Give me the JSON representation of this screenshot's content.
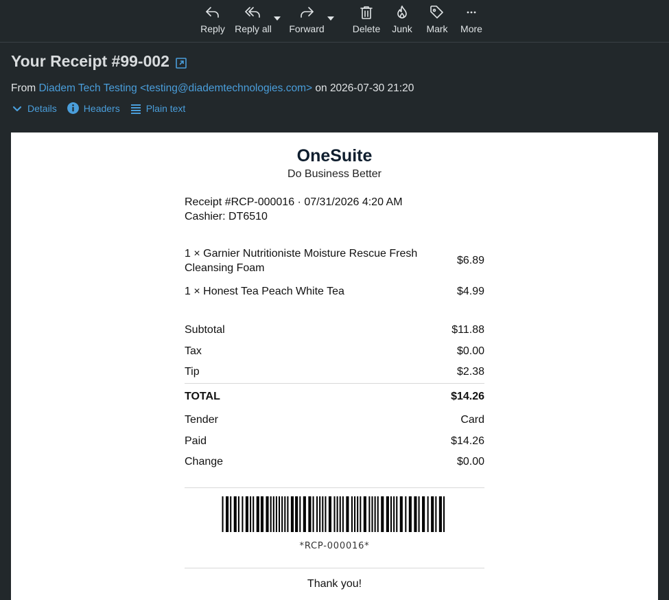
{
  "toolbar": {
    "reply": "Reply",
    "reply_all": "Reply all",
    "forward": "Forward",
    "delete": "Delete",
    "junk": "Junk",
    "mark": "Mark",
    "more": "More"
  },
  "message": {
    "subject": "Your Receipt #99-002",
    "from_prefix": "From",
    "sender": "Diadem Tech Testing <testing@diademtechnologies.com>",
    "date_text": "on 2026-07-30 21:20",
    "details": "Details",
    "headers": "Headers",
    "plain_text": "Plain text"
  },
  "receipt": {
    "store_name": "OneSuite",
    "tagline": "Do Business Better",
    "receipt_line": "Receipt #RCP-000016 · 07/31/2026 4:20 AM",
    "cashier_line": "Cashier: DT6510",
    "items": [
      {
        "desc": "1 × Garnier Nutritioniste Moisture Rescue Fresh Cleansing Foam",
        "price": "$6.89"
      },
      {
        "desc": "1 × Honest Tea Peach White Tea",
        "price": "$4.99"
      }
    ],
    "subtotal_label": "Subtotal",
    "subtotal": "$11.88",
    "tax_label": "Tax",
    "tax": "$0.00",
    "tip_label": "Tip",
    "tip": "$2.38",
    "total_label": "TOTAL",
    "total": "$14.26",
    "tender_label": "Tender",
    "tender": "Card",
    "paid_label": "Paid",
    "paid": "$14.26",
    "change_label": "Change",
    "change": "$0.00",
    "barcode_text": "*RCP-000016*",
    "thanks": "Thank you!"
  },
  "colors": {
    "background": "#22282b",
    "link": "#4a9edb",
    "receipt_bg": "#ffffff"
  }
}
